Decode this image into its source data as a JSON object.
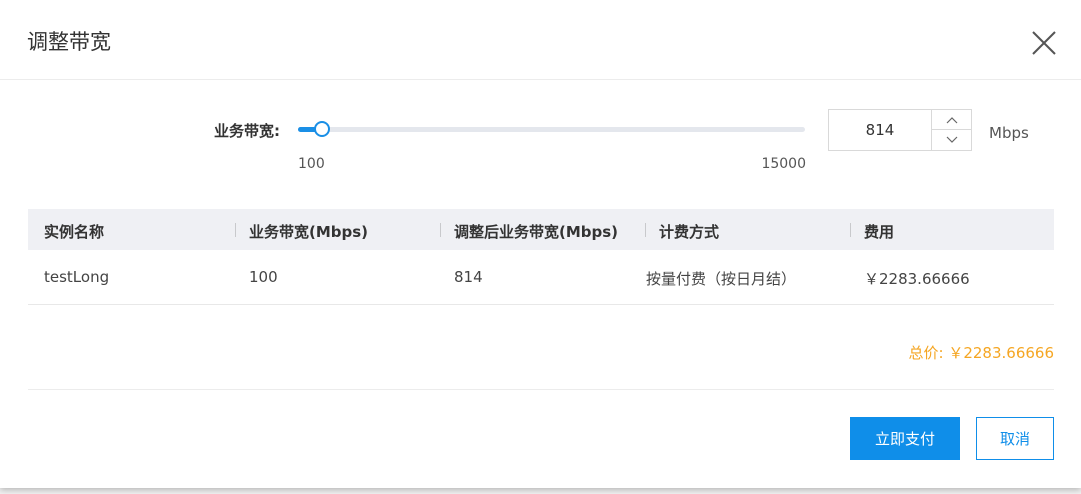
{
  "dialog": {
    "title": "调整带宽"
  },
  "slider": {
    "label": "业务带宽:",
    "min_label": "100",
    "max_label": "15000",
    "min": 100,
    "max": 15000,
    "value": 814
  },
  "bandwidth_input": {
    "value": "814",
    "unit": "Mbps"
  },
  "table": {
    "headers": [
      "实例名称",
      "业务带宽(Mbps)",
      "调整后业务带宽(Mbps)",
      "计费方式",
      "费用"
    ],
    "rows": [
      [
        "testLong",
        "100",
        "814",
        "按量付费（按日月结）",
        "￥2283.66666"
      ]
    ]
  },
  "total": {
    "text": "总价: ￥2283.66666"
  },
  "buttons": {
    "pay": "立即支付",
    "cancel": "取消"
  },
  "colors": {
    "accent": "#0f8ee9",
    "total": "#f5a623",
    "header_bg": "#eff0f4"
  },
  "icons": {
    "close": "close-icon",
    "up": "chevron-up-icon",
    "down": "chevron-down-icon"
  }
}
